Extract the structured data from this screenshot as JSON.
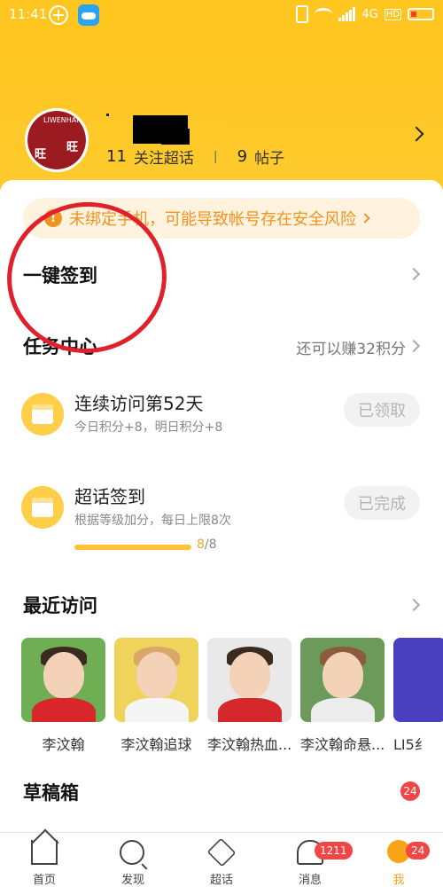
{
  "status_bar": {
    "time": "11:41",
    "network": "4G",
    "hd": "HD"
  },
  "profile": {
    "avatar_text_top": "LIWENHAN",
    "avatar_text_a": "旺",
    "avatar_text_b": "旺",
    "following_count": "11",
    "following_label": "关注超话",
    "posts_count": "9",
    "posts_label": "帖子",
    "separator": "|"
  },
  "warning": {
    "icon": "!",
    "text": "未绑定手机，可能导致帐号存在安全风险"
  },
  "one_key_checkin": "一键签到",
  "task_center": {
    "title": "任务中心",
    "hint": "还可以赚32积分",
    "tasks": [
      {
        "title": "连续访问第52天",
        "subtitle": "今日积分+8，明日积分+8",
        "button": "已领取",
        "icon": "calendar-icon"
      },
      {
        "title": "超话签到",
        "subtitle": "根据等级加分，每日上限8次",
        "button": "已完成",
        "icon": "calendar-check-icon",
        "progress_done": "8",
        "progress_total": "/8",
        "progress_fraction": 1.0
      }
    ]
  },
  "recent": {
    "title": "最近访问",
    "items": [
      {
        "label": "李汶翰"
      },
      {
        "label": "李汶翰追球"
      },
      {
        "label": "李汶翰热血..."
      },
      {
        "label": "李汶翰命悬..."
      },
      {
        "label": "LI5纟"
      }
    ]
  },
  "drafts": {
    "title": "草稿箱",
    "badge": "24"
  },
  "nav": {
    "items": [
      {
        "label": "首页",
        "icon": "home-icon"
      },
      {
        "label": "发现",
        "icon": "discover-icon"
      },
      {
        "label": "超话",
        "icon": "super-topic-icon"
      },
      {
        "label": "消息",
        "icon": "bell-icon",
        "badge": "1211"
      },
      {
        "label": "我",
        "icon": "profile-icon",
        "badge": "24"
      }
    ]
  },
  "colors": {
    "brand_yellow": "#ffc51f",
    "warning_orange": "#f19320",
    "badge_red": "#f04646",
    "annotation_red": "#e0202a"
  }
}
